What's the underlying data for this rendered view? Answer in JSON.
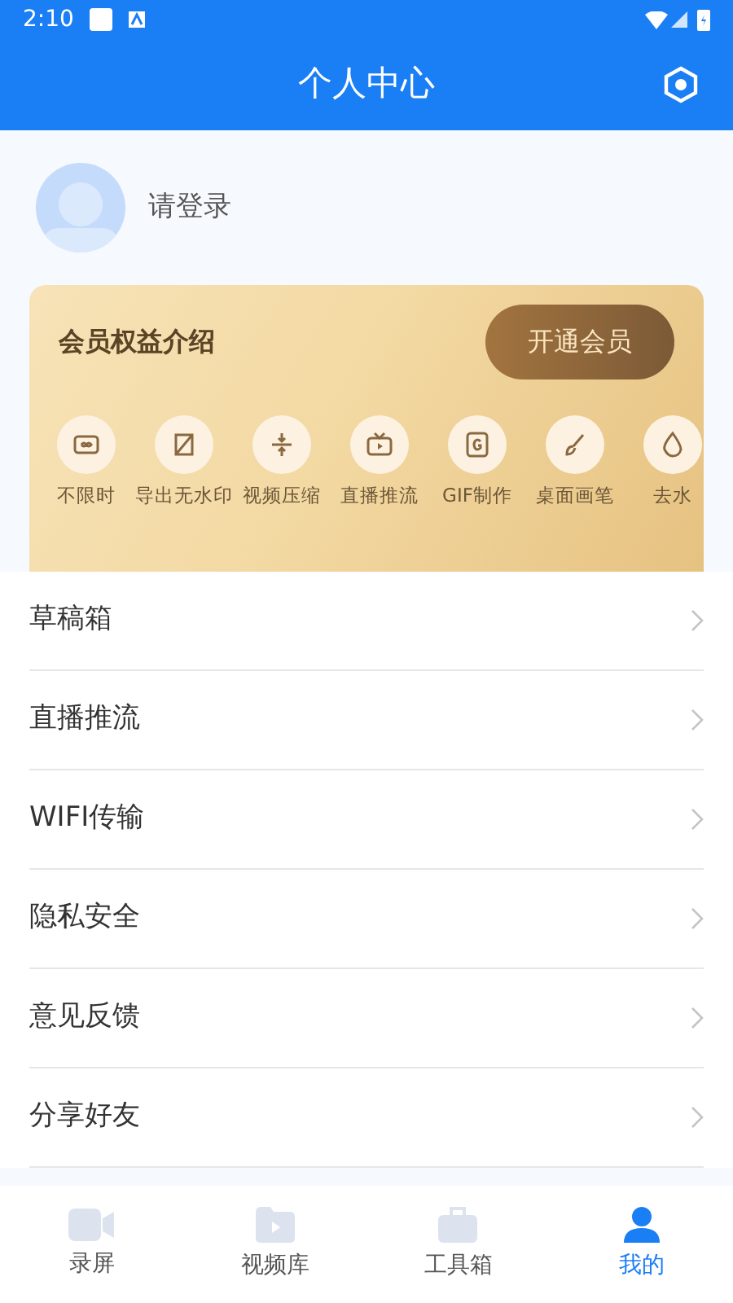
{
  "status_bar": {
    "time": "2:10"
  },
  "header": {
    "title": "个人中心"
  },
  "profile": {
    "login_text": "请登录"
  },
  "membership": {
    "title": "会员权益介绍",
    "button": "开通会员",
    "features": [
      {
        "kind": "infinity",
        "label": "不限时"
      },
      {
        "kind": "nowatermark",
        "label": "导出无水印"
      },
      {
        "kind": "compress",
        "label": "视频压缩"
      },
      {
        "kind": "tv",
        "label": "直播推流"
      },
      {
        "kind": "gif",
        "label": "GIF制作"
      },
      {
        "kind": "brush",
        "label": "桌面画笔"
      },
      {
        "kind": "drop",
        "label": "去水"
      }
    ]
  },
  "menu": [
    {
      "label": "草稿箱"
    },
    {
      "label": "直播推流"
    },
    {
      "label": "WIFI传输"
    },
    {
      "label": "隐私安全"
    },
    {
      "label": "意见反馈"
    },
    {
      "label": "分享好友"
    }
  ],
  "tab_bar": [
    {
      "kind": "record",
      "label": "录屏",
      "selected": false
    },
    {
      "kind": "library",
      "label": "视频库",
      "selected": false
    },
    {
      "kind": "tools",
      "label": "工具箱",
      "selected": false
    },
    {
      "kind": "me",
      "label": "我的",
      "selected": true
    }
  ]
}
